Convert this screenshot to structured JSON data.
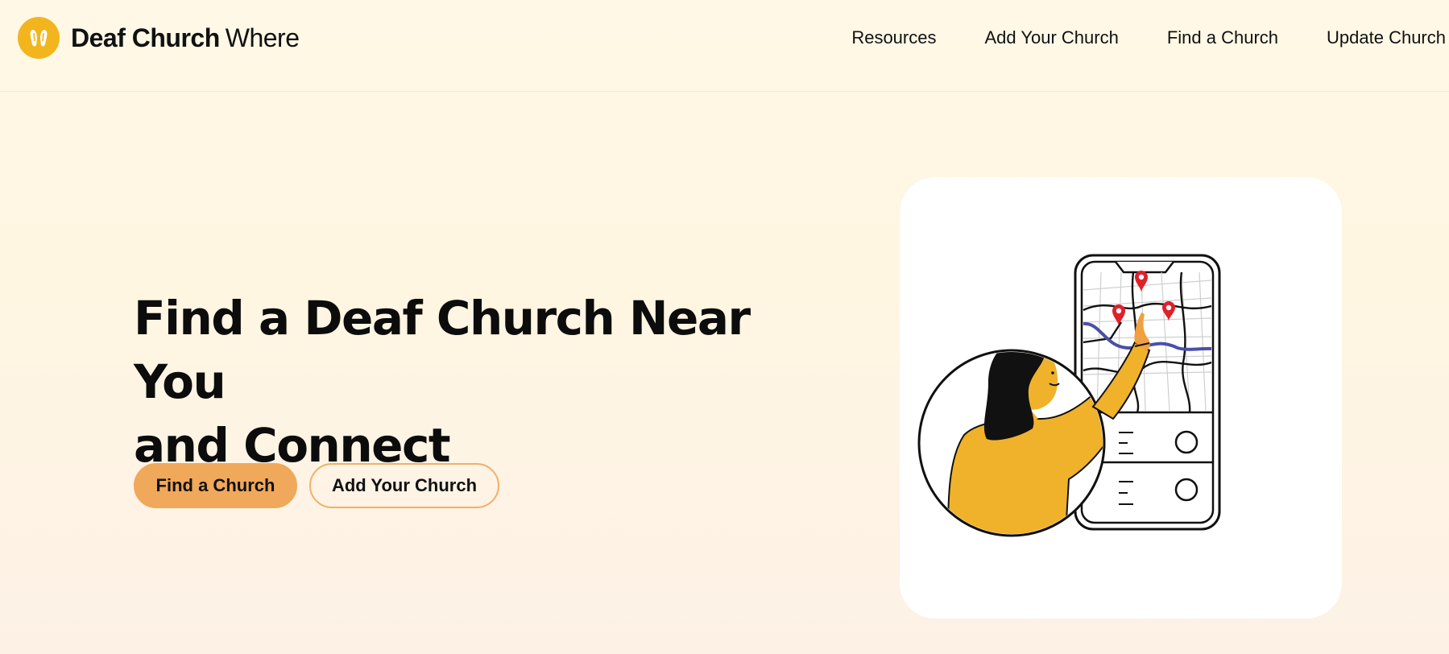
{
  "header": {
    "brand_bold": "Deaf Church",
    "brand_regular": "Where",
    "nav": [
      {
        "label": "Resources"
      },
      {
        "label": "Add Your Church"
      },
      {
        "label": "Find a Church"
      },
      {
        "label": "Update Church"
      }
    ]
  },
  "hero": {
    "title_line1": "Find a Deaf Church Near You",
    "title_line2": "and Connect",
    "primary_button": "Find a Church",
    "secondary_button": "Add Your Church"
  },
  "colors": {
    "brand_yellow": "#f2b51d",
    "button_orange": "#f0a85a",
    "pin_red": "#e0202a",
    "route_blue": "#4a4fa8"
  },
  "icons": {
    "logo": "hands-icon",
    "illustration": "map-phone-illustration"
  }
}
